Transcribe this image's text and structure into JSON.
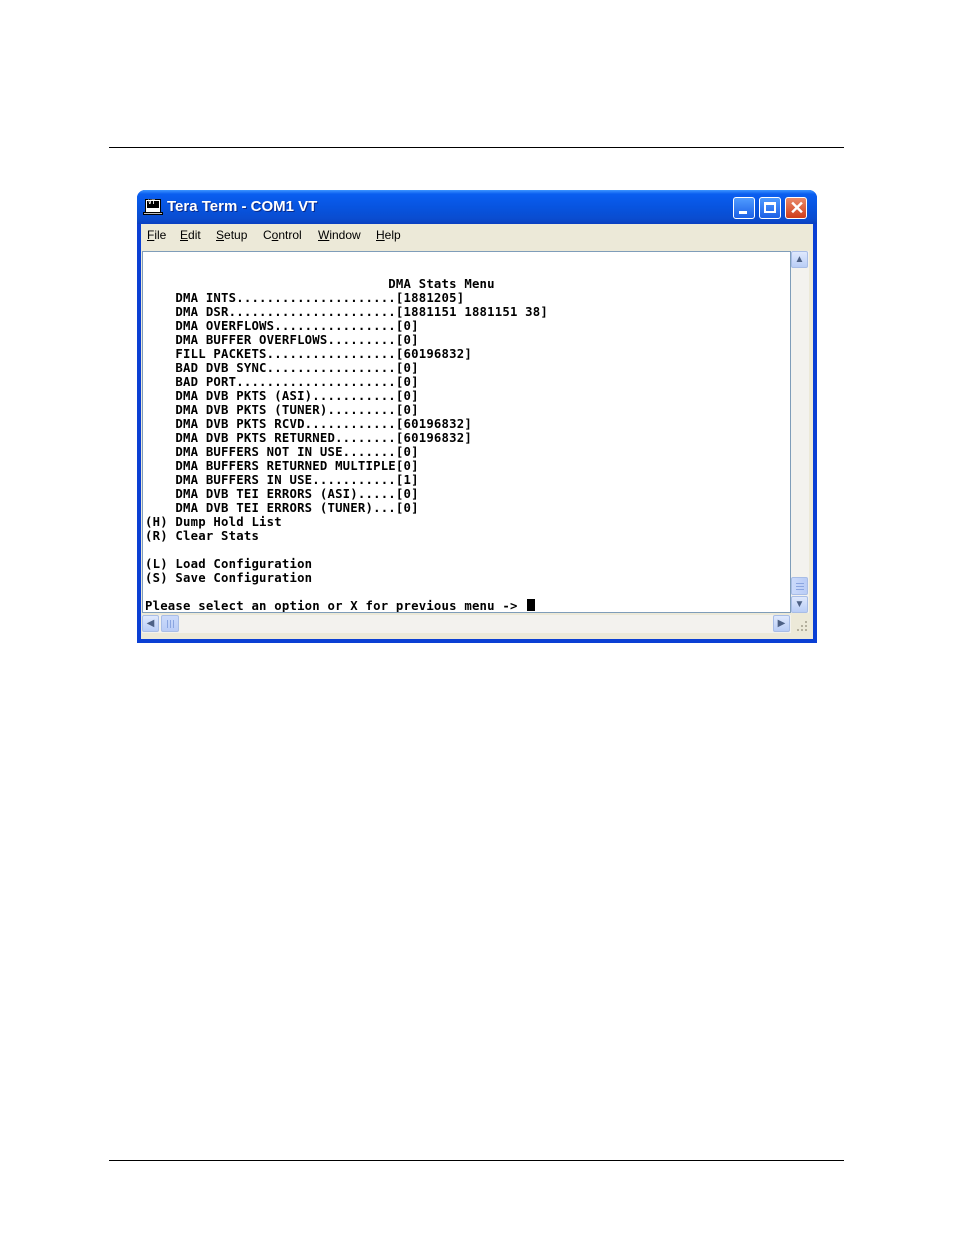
{
  "window": {
    "title": "Tera Term - COM1 VT",
    "icon_label": "VT"
  },
  "menubar": [
    {
      "accel": "F",
      "rest": "ile"
    },
    {
      "accel": "E",
      "rest": "dit"
    },
    {
      "accel": "S",
      "rest": "etup"
    },
    {
      "pre": "C",
      "accel": "o",
      "rest": "ntrol"
    },
    {
      "accel": "W",
      "rest": "indow"
    },
    {
      "accel": "H",
      "rest": "elp"
    }
  ],
  "terminal": {
    "heading": "                                DMA Stats Menu",
    "stats": [
      "    DMA INTS.....................[1881205]",
      "    DMA DSR......................[1881151 1881151 38]",
      "    DMA OVERFLOWS................[0]",
      "    DMA BUFFER OVERFLOWS.........[0]",
      "    FILL PACKETS.................[60196832]",
      "    BAD DVB SYNC.................[0]",
      "    BAD PORT.....................[0]",
      "    DMA DVB PKTS (ASI)...........[0]",
      "    DMA DVB PKTS (TUNER).........[0]",
      "    DMA DVB PKTS RCVD............[60196832]",
      "    DMA DVB PKTS RETURNED........[60196832]",
      "    DMA BUFFERS NOT IN USE.......[0]",
      "    DMA BUFFERS RETURNED MULTIPLE[0]",
      "    DMA BUFFERS IN USE...........[1]",
      "    DMA DVB TEI ERRORS (ASI).....[0]",
      "    DMA DVB TEI ERRORS (TUNER)...[0]"
    ],
    "options": [
      "(H) Dump Hold List",
      "(R) Clear Stats",
      "",
      "(L) Load Configuration",
      "(S) Save Configuration",
      ""
    ],
    "prompt": "Please select an option or X for previous menu -> "
  },
  "icons": [
    "app-icon",
    "minimize-icon",
    "maximize-icon",
    "close-icon",
    "scroll-up-icon",
    "scroll-down-icon",
    "scroll-left-icon",
    "scroll-right-icon",
    "size-grip-icon"
  ]
}
